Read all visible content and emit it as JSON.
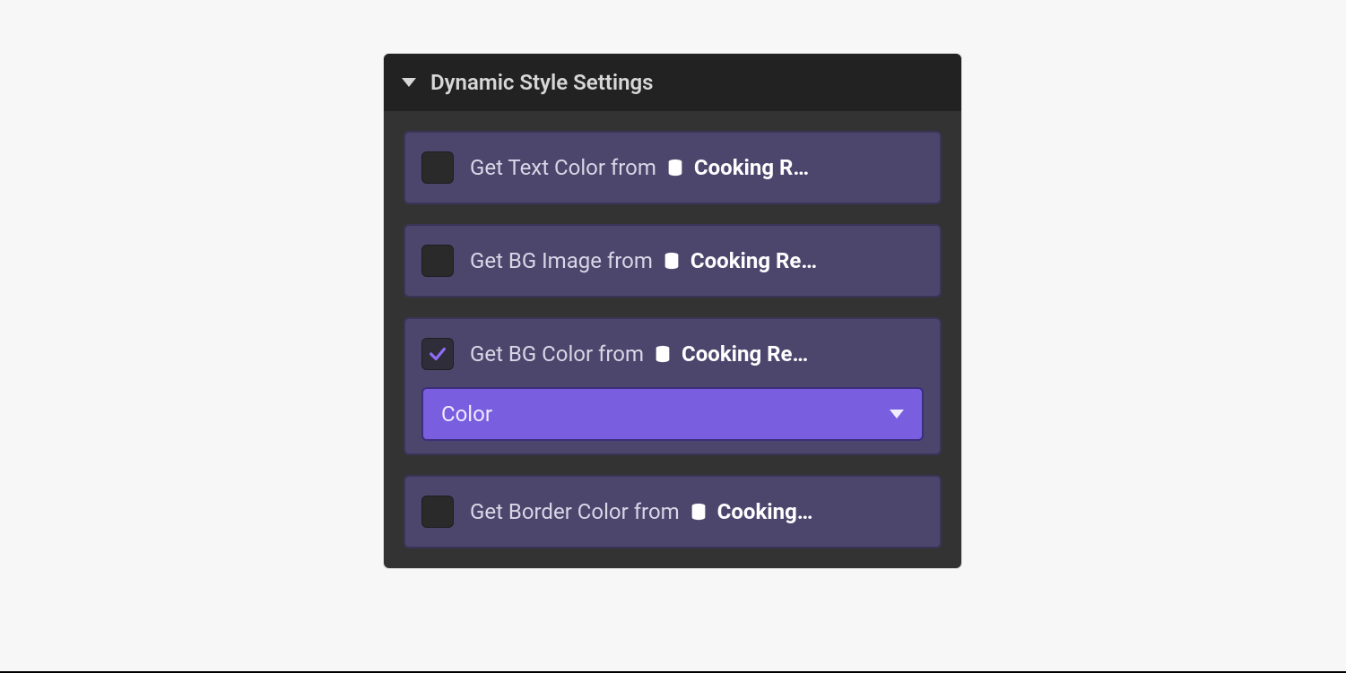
{
  "panel": {
    "title": "Dynamic Style Settings"
  },
  "rows": [
    {
      "checked": false,
      "label": "Get Text Color from",
      "source": "Cooking R…",
      "select": null
    },
    {
      "checked": false,
      "label": "Get BG Image from",
      "source": "Cooking Re…",
      "select": null
    },
    {
      "checked": true,
      "label": "Get BG Color from",
      "source": "Cooking Re…",
      "select": "Color"
    },
    {
      "checked": false,
      "label": "Get Border Color from",
      "source": "Cooking…",
      "select": null
    }
  ],
  "colors": {
    "accent": "#7a5ee0",
    "row_bg": "#4c466d",
    "panel_bg": "#333333",
    "header_bg": "#222222"
  }
}
